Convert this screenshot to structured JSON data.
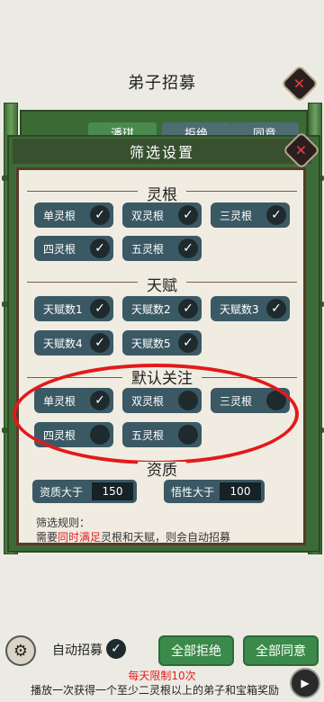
{
  "page": {
    "title": "弟子招募"
  },
  "background_card": {
    "tab_selected": "潘琪",
    "tab_reject": "拒绝",
    "tab_accept": "同意"
  },
  "panel": {
    "header": "筛选设置"
  },
  "spirit_root": {
    "title": "灵根",
    "items": [
      {
        "label": "单灵根",
        "checked": true
      },
      {
        "label": "双灵根",
        "checked": true
      },
      {
        "label": "三灵根",
        "checked": true
      },
      {
        "label": "四灵根",
        "checked": true
      },
      {
        "label": "五灵根",
        "checked": true
      }
    ]
  },
  "talent": {
    "title": "天赋",
    "items": [
      {
        "label": "天赋数1",
        "checked": true
      },
      {
        "label": "天赋数2",
        "checked": true
      },
      {
        "label": "天赋数3",
        "checked": true
      },
      {
        "label": "天赋数4",
        "checked": true
      },
      {
        "label": "天赋数5",
        "checked": true
      }
    ]
  },
  "default_focus": {
    "title": "默认关注",
    "items": [
      {
        "label": "单灵根",
        "checked": true
      },
      {
        "label": "双灵根",
        "checked": false
      },
      {
        "label": "三灵根",
        "checked": false
      },
      {
        "label": "四灵根",
        "checked": false
      },
      {
        "label": "五灵根",
        "checked": false
      }
    ]
  },
  "aptitude": {
    "title": "资质",
    "aptitude_label": "资质大于",
    "aptitude_value": "150",
    "comprehension_label": "悟性大于",
    "comprehension_value": "100"
  },
  "rules": {
    "title": "筛选规则：",
    "line_prefix": "需要",
    "line_highlight": "同时满足",
    "line_suffix": "灵根和天赋，则会自动招募"
  },
  "bottom": {
    "auto_recruit_label": "自动招募",
    "auto_recruit_checked": true,
    "reject_all": "全部拒绝",
    "accept_all": "全部同意",
    "daily_limit": "每天限制10次",
    "ad_text": "播放一次获得一个至少二灵根以上的弟子和宝箱奖励"
  },
  "colors": {
    "bamboo": "#4f8a45",
    "pill": "#3b5964",
    "annotation": "#e21a1a",
    "accent_red": "#e02020"
  }
}
